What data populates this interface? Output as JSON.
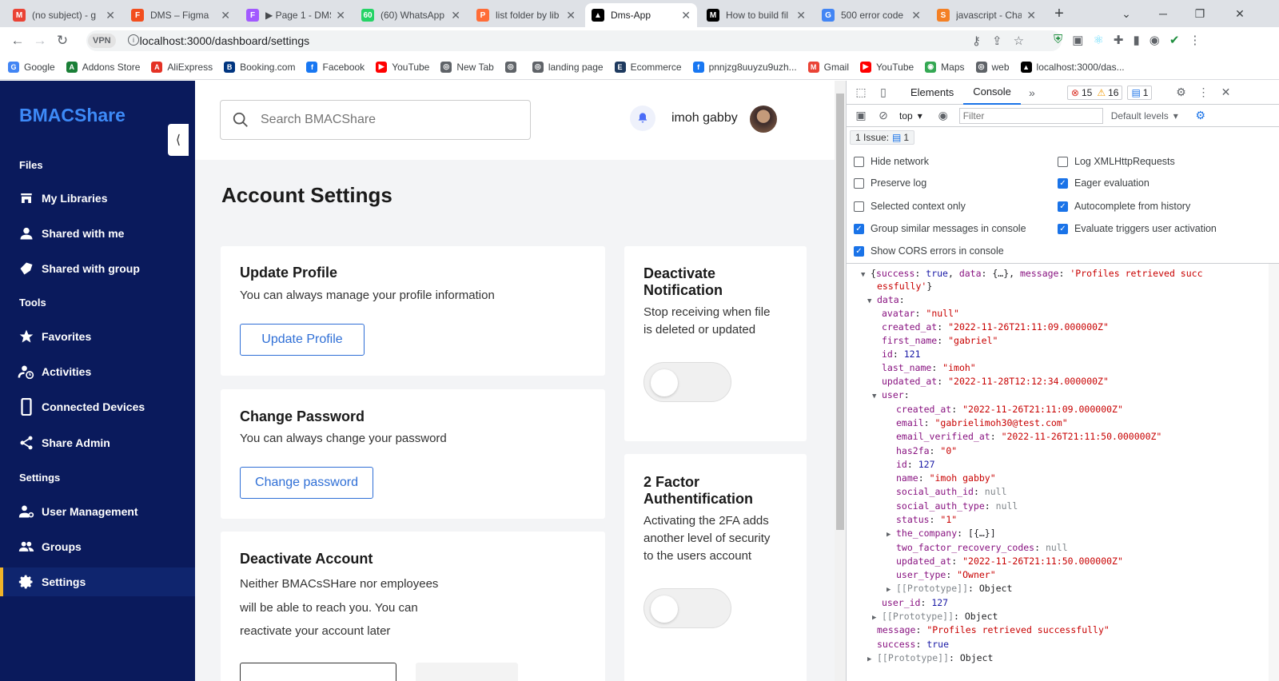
{
  "browser": {
    "tabs": [
      {
        "title": "(no subject) - g",
        "icon": "gmail-icon",
        "color": "#ea4335",
        "letter": "M"
      },
      {
        "title": "DMS – Figma",
        "icon": "figma-icon",
        "color": "#f24e1e",
        "letter": "F"
      },
      {
        "title": "▶ Page 1 - DMS",
        "icon": "figma-icon",
        "color": "#a259ff",
        "letter": "F"
      },
      {
        "title": "(60) WhatsApp",
        "icon": "whatsapp-icon",
        "color": "#25d366",
        "letter": "60"
      },
      {
        "title": "list folder by lib",
        "icon": "postman-icon",
        "color": "#ff6c37",
        "letter": "P"
      },
      {
        "title": "Dms-App",
        "icon": "app-icon",
        "color": "#000000",
        "letter": "▲"
      },
      {
        "title": "How to build fil",
        "icon": "medium-icon",
        "color": "#000000",
        "letter": "M"
      },
      {
        "title": "500 error code",
        "icon": "google-icon",
        "color": "#4285f4",
        "letter": "G"
      },
      {
        "title": "javascript - Cha",
        "icon": "stackoverflow-icon",
        "color": "#f48024",
        "letter": "S"
      }
    ],
    "url": "localhost:3000/dashboard/settings",
    "vpn": "VPN",
    "bookmarks": [
      {
        "label": "Google",
        "color": "#4285f4",
        "letter": "G"
      },
      {
        "label": "Addons Store",
        "color": "#1a7f37",
        "letter": "A"
      },
      {
        "label": "AliExpress",
        "color": "#e43225",
        "letter": "A"
      },
      {
        "label": "Booking.com",
        "color": "#003580",
        "letter": "B"
      },
      {
        "label": "Facebook",
        "color": "#1877f2",
        "letter": "f"
      },
      {
        "label": "YouTube",
        "color": "#ff0000",
        "letter": "▶"
      },
      {
        "label": "New Tab",
        "color": "#5f6368",
        "letter": "◎"
      },
      {
        "label": "",
        "color": "#5f6368",
        "letter": "◎"
      },
      {
        "label": "landing page",
        "color": "#5f6368",
        "letter": "◎"
      },
      {
        "label": "Ecommerce",
        "color": "#1e3a5f",
        "letter": "E"
      },
      {
        "label": "pnnjzg8uuyzu9uzh...",
        "color": "#1877f2",
        "letter": "f"
      },
      {
        "label": "Gmail",
        "color": "#ea4335",
        "letter": "M"
      },
      {
        "label": "YouTube",
        "color": "#ff0000",
        "letter": "▶"
      },
      {
        "label": "Maps",
        "color": "#34a853",
        "letter": "◉"
      },
      {
        "label": "web",
        "color": "#5f6368",
        "letter": "◎"
      },
      {
        "label": "localhost:3000/das...",
        "color": "#000000",
        "letter": "▲"
      }
    ]
  },
  "sidebar": {
    "brand": "BMACShare",
    "sections": {
      "files": "Files",
      "tools": "Tools",
      "settings": "Settings"
    },
    "items": [
      {
        "label": "My Libraries",
        "icon": "store-icon"
      },
      {
        "label": "Shared with me",
        "icon": "user-icon"
      },
      {
        "label": "Shared with group",
        "icon": "tag-icon"
      },
      {
        "label": "Favorites",
        "icon": "star-icon"
      },
      {
        "label": "Activities",
        "icon": "activity-icon"
      },
      {
        "label": "Connected Devices",
        "icon": "phone-icon"
      },
      {
        "label": "Share Admin",
        "icon": "share-icon"
      },
      {
        "label": "User Management",
        "icon": "user-gear-icon"
      },
      {
        "label": "Groups",
        "icon": "groups-icon"
      },
      {
        "label": "Settings",
        "icon": "gear-icon"
      }
    ]
  },
  "header": {
    "search_placeholder": "Search BMACShare",
    "user_name": "imoh gabby"
  },
  "page": {
    "title": "Account Settings",
    "update_profile": {
      "title": "Update Profile",
      "desc": "You can always manage your profile information",
      "button": "Update Profile"
    },
    "change_password": {
      "title": "Change Password",
      "desc": "You can always change your password",
      "button": "Change password"
    },
    "deactivate_account": {
      "title": "Deactivate Account",
      "line1": "Neither BMACsSHare nor employees",
      "line2": "will be able to reach you. You can",
      "line3": "reactivate your account later"
    },
    "deactivate_notification": {
      "title1": "Deactivate",
      "title2": "Notification",
      "line1": "Stop receiving when file",
      "line2": "is deleted or updated",
      "enabled": false
    },
    "two_factor": {
      "title1": "2 Factor",
      "title2": "Authentification",
      "line1": "Activating the 2FA adds",
      "line2": "another level of security",
      "line3": "to the users account",
      "enabled": false
    }
  },
  "devtools": {
    "tabs": [
      "Elements",
      "Console"
    ],
    "errors": "15",
    "warnings": "16",
    "messages": "1",
    "context": "top",
    "filter_placeholder": "Filter",
    "levels": "Default levels",
    "issues": "1 Issue:",
    "issues_count": "1",
    "options_left": [
      {
        "label": "Hide network",
        "checked": false
      },
      {
        "label": "Preserve log",
        "checked": false
      },
      {
        "label": "Selected context only",
        "checked": false
      },
      {
        "label": "Group similar messages in console",
        "checked": true
      },
      {
        "label": "Show CORS errors in console",
        "checked": true
      }
    ],
    "options_right": [
      {
        "label": "Log XMLHttpRequests",
        "checked": false
      },
      {
        "label": "Eager evaluation",
        "checked": true
      },
      {
        "label": "Autocomplete from history",
        "checked": true
      },
      {
        "label": "Evaluate triggers user activation",
        "checked": true
      }
    ],
    "console_lines": [
      {
        "indent": 0,
        "arrow": "▼",
        "parts": [
          [
            "o",
            "{"
          ],
          [
            "k",
            "success"
          ],
          [
            "o",
            ": "
          ],
          [
            "n",
            "true"
          ],
          [
            "o",
            ", "
          ],
          [
            "k",
            "data"
          ],
          [
            "o",
            ": {…}, "
          ],
          [
            "k",
            "message"
          ],
          [
            "o",
            ": "
          ],
          [
            "s",
            "'Profiles retrieved succ"
          ]
        ]
      },
      {
        "indent": 0,
        "arrow": "",
        "parts": [
          [
            "s",
            "essfully'"
          ],
          [
            "o",
            "} "
          ]
        ]
      },
      {
        "indent": 1,
        "arrow": "▼",
        "parts": [
          [
            "k",
            "data"
          ],
          [
            "o",
            ":"
          ]
        ]
      },
      {
        "indent": 2,
        "arrow": "",
        "parts": [
          [
            "k",
            "avatar"
          ],
          [
            "o",
            ": "
          ],
          [
            "s",
            "\"null\""
          ]
        ]
      },
      {
        "indent": 2,
        "arrow": "",
        "parts": [
          [
            "k",
            "created_at"
          ],
          [
            "o",
            ": "
          ],
          [
            "s",
            "\"2022-11-26T21:11:09.000000Z\""
          ]
        ]
      },
      {
        "indent": 2,
        "arrow": "",
        "parts": [
          [
            "k",
            "first_name"
          ],
          [
            "o",
            ": "
          ],
          [
            "s",
            "\"gabriel\""
          ]
        ]
      },
      {
        "indent": 2,
        "arrow": "",
        "parts": [
          [
            "k",
            "id"
          ],
          [
            "o",
            ": "
          ],
          [
            "n",
            "121"
          ]
        ]
      },
      {
        "indent": 2,
        "arrow": "",
        "parts": [
          [
            "k",
            "last_name"
          ],
          [
            "o",
            ": "
          ],
          [
            "s",
            "\"imoh\""
          ]
        ]
      },
      {
        "indent": 2,
        "arrow": "",
        "parts": [
          [
            "k",
            "updated_at"
          ],
          [
            "o",
            ": "
          ],
          [
            "s",
            "\"2022-11-28T12:12:34.000000Z\""
          ]
        ]
      },
      {
        "indent": 2,
        "arrow": "▼",
        "parts": [
          [
            "k",
            "user"
          ],
          [
            "o",
            ":"
          ]
        ]
      },
      {
        "indent": 3,
        "arrow": "",
        "parts": [
          [
            "k",
            "created_at"
          ],
          [
            "o",
            ": "
          ],
          [
            "s",
            "\"2022-11-26T21:11:09.000000Z\""
          ]
        ]
      },
      {
        "indent": 3,
        "arrow": "",
        "parts": [
          [
            "k",
            "email"
          ],
          [
            "o",
            ": "
          ],
          [
            "s",
            "\"gabrielimoh30@test.com\""
          ]
        ]
      },
      {
        "indent": 3,
        "arrow": "",
        "parts": [
          [
            "k",
            "email_verified_at"
          ],
          [
            "o",
            ": "
          ],
          [
            "s",
            "\"2022-11-26T21:11:50.000000Z\""
          ]
        ]
      },
      {
        "indent": 3,
        "arrow": "",
        "parts": [
          [
            "k",
            "has2fa"
          ],
          [
            "o",
            ": "
          ],
          [
            "s",
            "\"0\""
          ]
        ]
      },
      {
        "indent": 3,
        "arrow": "",
        "parts": [
          [
            "k",
            "id"
          ],
          [
            "o",
            ": "
          ],
          [
            "n",
            "127"
          ]
        ]
      },
      {
        "indent": 3,
        "arrow": "",
        "parts": [
          [
            "k",
            "name"
          ],
          [
            "o",
            ": "
          ],
          [
            "s",
            "\"imoh gabby\""
          ]
        ]
      },
      {
        "indent": 3,
        "arrow": "",
        "parts": [
          [
            "k",
            "social_auth_id"
          ],
          [
            "o",
            ": "
          ],
          [
            "g",
            "null"
          ]
        ]
      },
      {
        "indent": 3,
        "arrow": "",
        "parts": [
          [
            "k",
            "social_auth_type"
          ],
          [
            "o",
            ": "
          ],
          [
            "g",
            "null"
          ]
        ]
      },
      {
        "indent": 3,
        "arrow": "",
        "parts": [
          [
            "k",
            "status"
          ],
          [
            "o",
            ": "
          ],
          [
            "s",
            "\"1\""
          ]
        ]
      },
      {
        "indent": 3,
        "arrow": "▶",
        "parts": [
          [
            "k",
            "the_company"
          ],
          [
            "o",
            ": [{…}]"
          ]
        ]
      },
      {
        "indent": 3,
        "arrow": "",
        "parts": [
          [
            "k",
            "two_factor_recovery_codes"
          ],
          [
            "o",
            ": "
          ],
          [
            "g",
            "null"
          ]
        ]
      },
      {
        "indent": 3,
        "arrow": "",
        "parts": [
          [
            "k",
            "updated_at"
          ],
          [
            "o",
            ": "
          ],
          [
            "s",
            "\"2022-11-26T21:11:50.000000Z\""
          ]
        ]
      },
      {
        "indent": 3,
        "arrow": "",
        "parts": [
          [
            "k",
            "user_type"
          ],
          [
            "o",
            ": "
          ],
          [
            "s",
            "\"Owner\""
          ]
        ]
      },
      {
        "indent": 3,
        "arrow": "▶",
        "parts": [
          [
            "g",
            "[[Prototype]]"
          ],
          [
            "o",
            ": Object"
          ]
        ]
      },
      {
        "indent": 2,
        "arrow": "",
        "parts": [
          [
            "k",
            "user_id"
          ],
          [
            "o",
            ": "
          ],
          [
            "n",
            "127"
          ]
        ]
      },
      {
        "indent": 2,
        "arrow": "▶",
        "parts": [
          [
            "g",
            "[[Prototype]]"
          ],
          [
            "o",
            ": Object"
          ]
        ]
      },
      {
        "indent": 1,
        "arrow": "",
        "parts": [
          [
            "k",
            "message"
          ],
          [
            "o",
            ": "
          ],
          [
            "s",
            "\"Profiles retrieved successfully\""
          ]
        ]
      },
      {
        "indent": 1,
        "arrow": "",
        "parts": [
          [
            "k",
            "success"
          ],
          [
            "o",
            ": "
          ],
          [
            "n",
            "true"
          ]
        ]
      },
      {
        "indent": 1,
        "arrow": "▶",
        "parts": [
          [
            "g",
            "[[Prototype]]"
          ],
          [
            "o",
            ": Object"
          ]
        ]
      }
    ]
  }
}
